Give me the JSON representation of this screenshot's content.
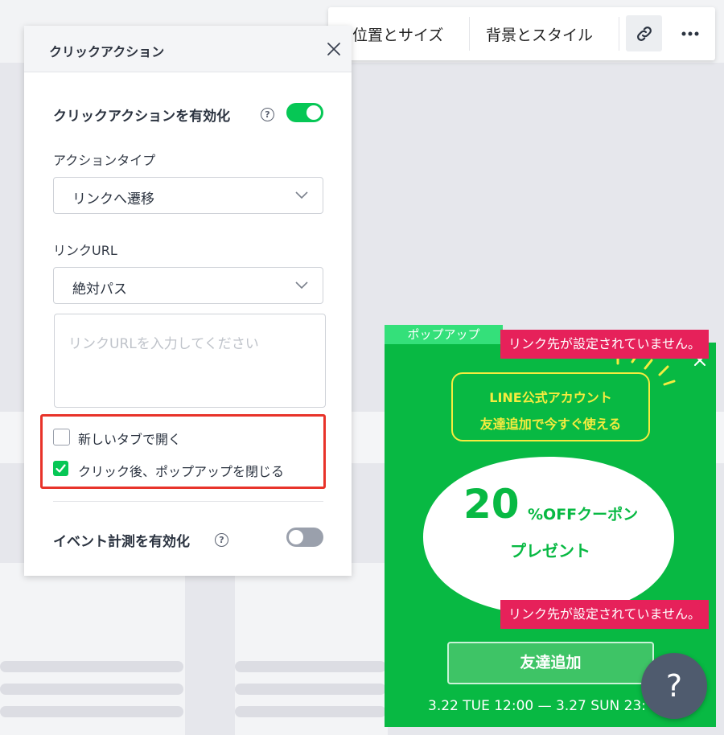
{
  "toolbar": {
    "position_size": "位置とサイズ",
    "background_style": "背景とスタイル",
    "link_icon": "link-icon",
    "more_icon": "more-horizontal-icon"
  },
  "panel": {
    "title": "クリックアクション",
    "enable_click_action": {
      "label": "クリックアクションを有効化",
      "enabled": true
    },
    "action_type": {
      "label": "アクションタイプ",
      "selected": "リンクへ遷移"
    },
    "link_url": {
      "label": "リンクURL",
      "path_type_selected": "絶対パス",
      "placeholder": "リンクURLを入力してください",
      "value": ""
    },
    "options": [
      {
        "label": "新しいタブで開く",
        "checked": false
      },
      {
        "label": "クリック後、ポップアップを閉じる",
        "checked": true
      }
    ],
    "enable_event_tracking": {
      "label": "イベント計測を有効化",
      "enabled": false
    },
    "help_glyph": "?"
  },
  "popup": {
    "tag": "ポップアップ",
    "warning_top": "リンク先が設定されていません。",
    "warning_bottom": "リンク先が設定されていません。",
    "line_account": "LINE公式アカウント",
    "line_subtext": "友達追加で今すぐ使える",
    "discount_number": "20",
    "discount_text": "%OFFクーポン",
    "present": "プレゼント",
    "add_friend_button": "友達追加",
    "dates": "3.22 TUE 12:00 — 3.27 SUN 23:",
    "colors": {
      "popup_bg": "#08b943",
      "accent": "#f5ec3f",
      "warning": "#e6215a"
    }
  },
  "help_fab": {
    "glyph": "?"
  },
  "colors": {
    "toggle_on": "#06c755",
    "highlight_border": "#e8332a"
  }
}
